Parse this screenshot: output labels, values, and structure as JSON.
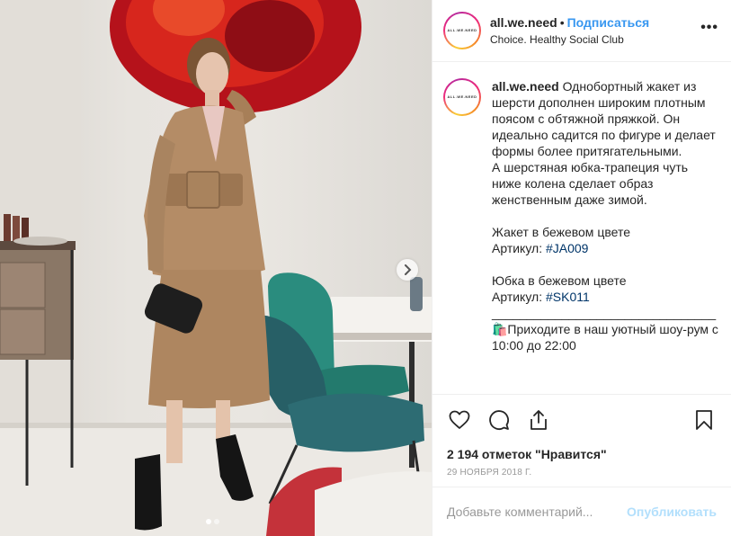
{
  "header": {
    "username": "all.we.need",
    "bullet": "•",
    "follow_label": "Подписаться",
    "location": "Choice. Healthy Social Club",
    "avatar_text": "ALL.WE.NEED",
    "more_label": "•••"
  },
  "caption": {
    "username": "all.we.need",
    "text_part1": " Однобортный жакет из шерсти дополнен широким плотным поясом с обтяжной пряжкой. Он идеально садится по фигуре и делает формы более притягательными.\nА шерстяная юбка-трапеция чуть ниже колена сделает образ женственным даже зимой.\n\nЖакет в бежевом цвете\nАртикул: ",
    "tag1": "#JA009",
    "text_part2": "\n\nЮбка в бежевом цвете\nАртикул: ",
    "tag2": "#SK011",
    "text_part3": "\n________________________________\n🛍️Приходите в наш уютный шоу-рум с 10:00 до 22:00"
  },
  "actions": {
    "like_icon": "heart-icon",
    "comment_icon": "comment-icon",
    "share_icon": "share-icon",
    "save_icon": "bookmark-icon"
  },
  "likes_text": "2 194 отметок \"Нравится\"",
  "date": "29 ноября 2018 г.",
  "comment": {
    "placeholder": "Добавьте комментарий...",
    "value": "",
    "publish_label": "Опубликовать"
  },
  "carousel": {
    "next_icon": "chevron-right-icon",
    "dots_total": 2,
    "active_dot": 1
  },
  "colors": {
    "accent": "#3897f0",
    "publish_disabled": "#b2dffc",
    "hashtag": "#003569",
    "meta_gray": "#999999"
  }
}
